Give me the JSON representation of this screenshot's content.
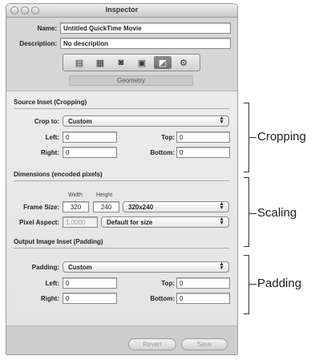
{
  "window": {
    "title": "Inspector"
  },
  "header": {
    "name_label": "Name:",
    "name_value": "Untitled QuickTime Movie",
    "description_label": "Description:",
    "description_value": "No description"
  },
  "toolbar": {
    "buttons": [
      {
        "icon": "summary-icon",
        "glyph": "▤"
      },
      {
        "icon": "video-icon",
        "glyph": "▦"
      },
      {
        "icon": "audio-icon",
        "glyph": "◙"
      },
      {
        "icon": "stream-icon",
        "glyph": "▣"
      },
      {
        "icon": "geometry-icon",
        "glyph": "◩"
      },
      {
        "icon": "actions-icon",
        "glyph": "⚙"
      }
    ],
    "selected_tab": "Geometry"
  },
  "source_inset": {
    "heading": "Source Inset (Cropping)",
    "crop_to_label": "Crop to:",
    "crop_to_value": "Custom",
    "left_label": "Left:",
    "left_value": "0",
    "top_label": "Top:",
    "top_value": "0",
    "right_label": "Right:",
    "right_value": "0",
    "bottom_label": "Bottom:",
    "bottom_value": "0"
  },
  "dimensions": {
    "heading": "Dimensions (encoded pixels)",
    "width_header": "Width",
    "height_header": "Height",
    "frame_size_label": "Frame Size:",
    "width_value": "320",
    "height_value": "240",
    "frame_size_preset": "320x240",
    "pixel_aspect_label": "Pixel Aspect:",
    "pixel_aspect_value": "1.0000",
    "pixel_aspect_preset": "Default for size"
  },
  "output_inset": {
    "heading": "Output Image Inset (Padding)",
    "padding_label": "Padding:",
    "padding_value": "Custom",
    "left_label": "Left:",
    "left_value": "0",
    "top_label": "Top:",
    "top_value": "0",
    "right_label": "Right:",
    "right_value": "0",
    "bottom_label": "Bottom:",
    "bottom_value": "0"
  },
  "footer": {
    "revert_label": "Revert",
    "save_label": "Save"
  },
  "callouts": {
    "cropping": "Cropping",
    "scaling": "Scaling",
    "padding": "Padding"
  }
}
